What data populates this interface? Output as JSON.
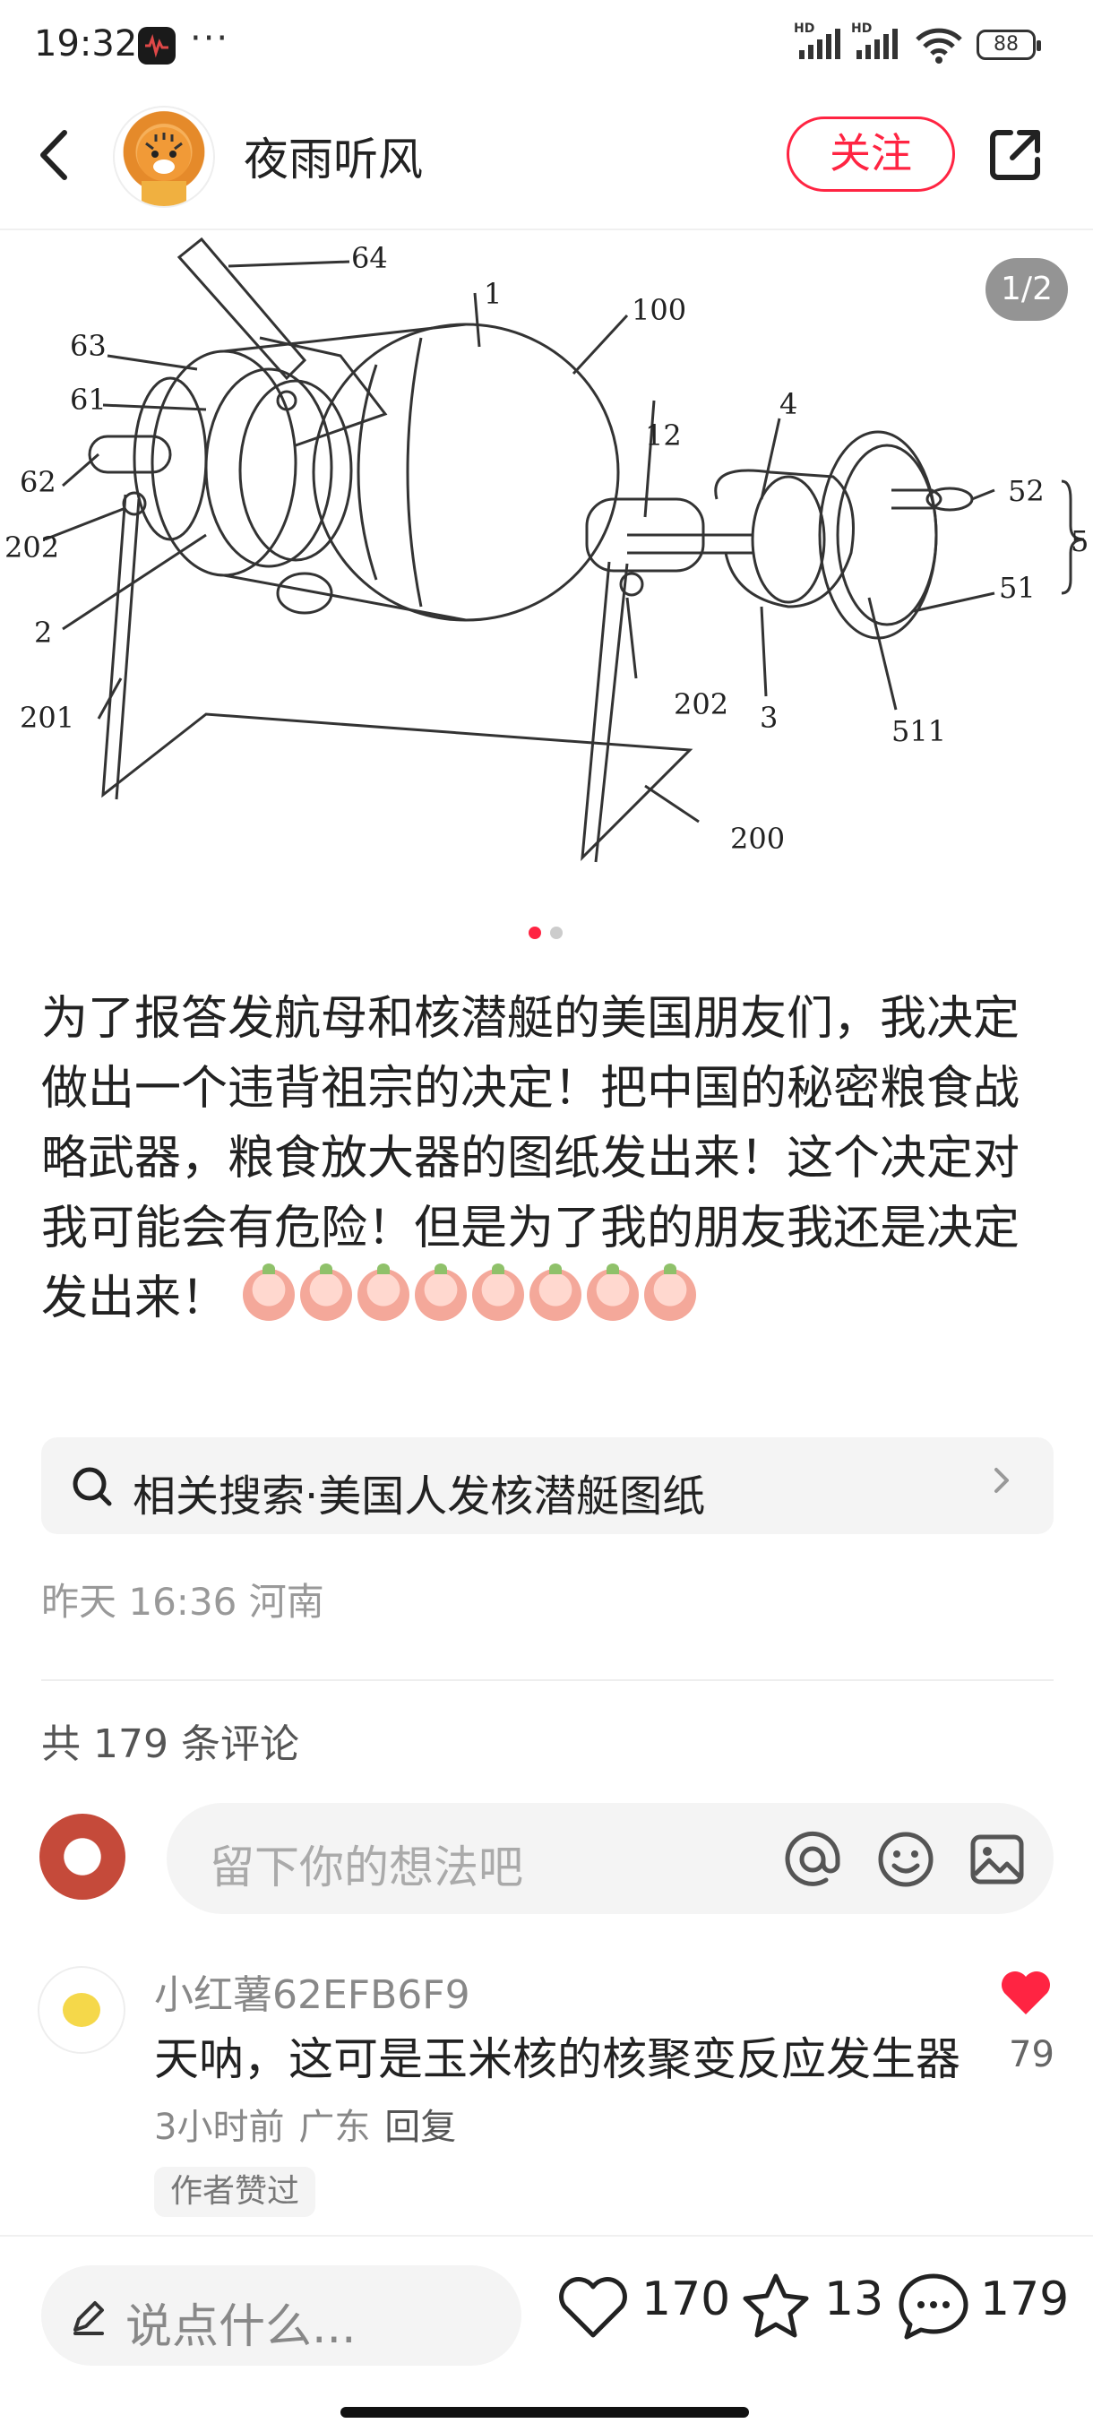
{
  "status_bar": {
    "time": "19:32",
    "dots": "···",
    "signal_label": "HD",
    "battery": "88"
  },
  "header": {
    "author": "夜雨听风",
    "follow_label": "关注"
  },
  "image": {
    "pager": "1/2",
    "total": 2,
    "current": 1,
    "labels": [
      "64",
      "1",
      "100",
      "63",
      "61",
      "4",
      "12",
      "62",
      "52",
      "5",
      "202",
      "51",
      "2",
      "202",
      "3",
      "201",
      "511",
      "200"
    ]
  },
  "post": {
    "text": "为了报答发航母和核潜艇的美国朋友们，我决定做出一个违背祖宗的决定！把中国的秘密粮食战略武器，粮食放大器的图纸发出来！这个决定对我可能会有危险！但是为了我的朋友我还是决定发出来！",
    "emoji_count": 8
  },
  "related_search": {
    "label": "相关搜索·美国人发核潜艇图纸"
  },
  "meta": {
    "time_location": "昨天 16:36 河南"
  },
  "comments": {
    "count_label": "共 179 条评论",
    "input_placeholder": "留下你的想法吧",
    "items": [
      {
        "user": "小红薯62EFB6F9",
        "text": "天呐，这可是玉米核的核聚变反应发生器",
        "time": "3小时前",
        "location": "广东",
        "reply_label": "回复",
        "badge": "作者赞过",
        "likes": "79"
      }
    ]
  },
  "bottom_bar": {
    "placeholder": "说点什么...",
    "likes": "170",
    "collects": "13",
    "comments": "179"
  },
  "colors": {
    "accent": "#ff2442",
    "text": "#222222",
    "muted": "#999999"
  }
}
